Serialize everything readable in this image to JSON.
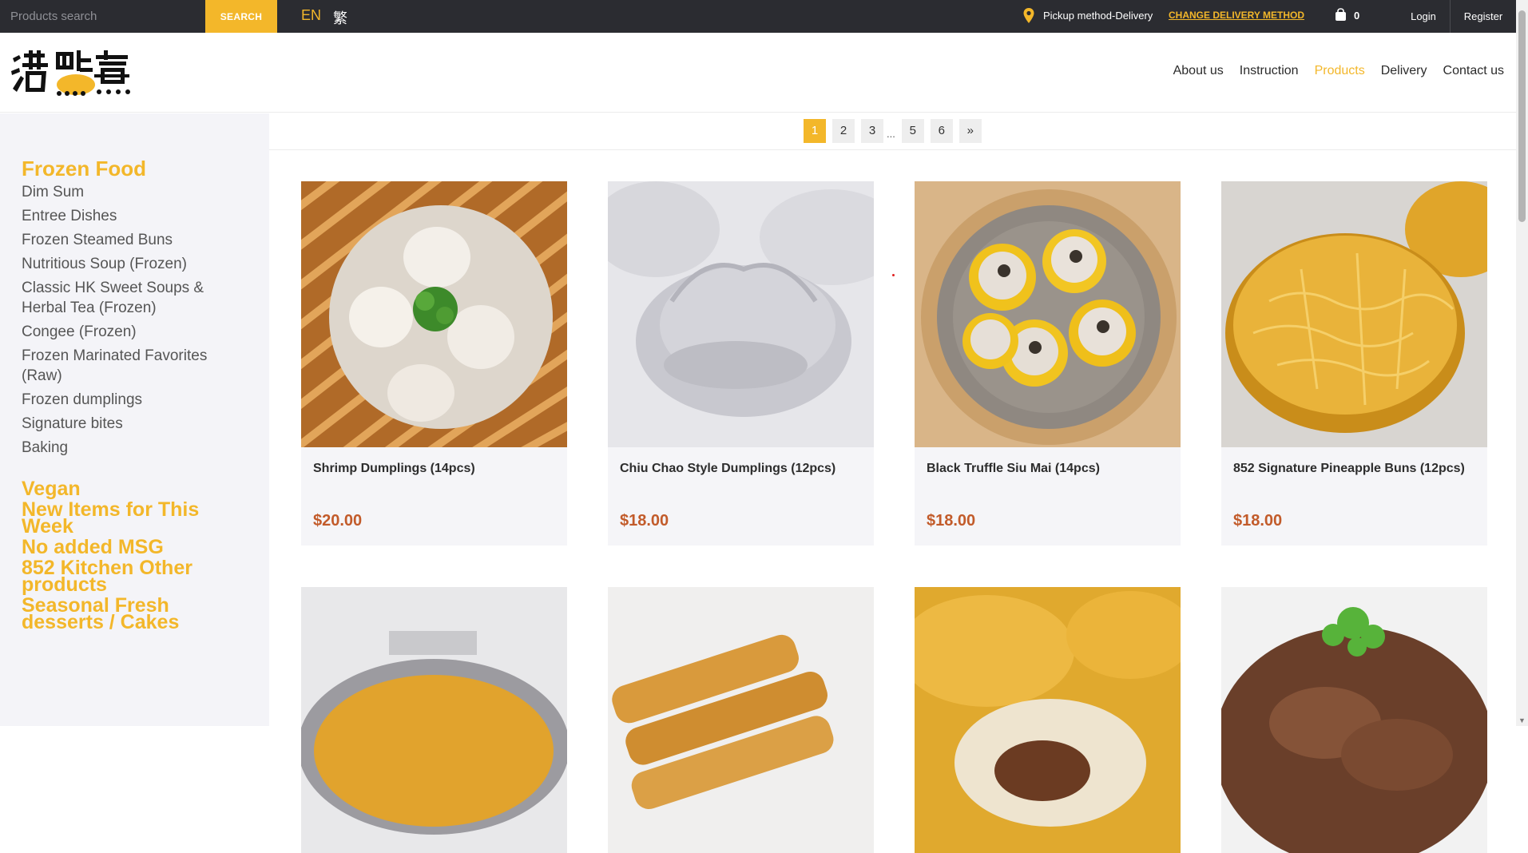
{
  "topbar": {
    "search_placeholder": "Products search",
    "search_button": "SEARCH",
    "lang_en": "EN",
    "lang_tc": "繁",
    "pickup_text": "Pickup method-Delivery",
    "change_delivery": "CHANGE DELIVERY METHOD",
    "cart_count": "0",
    "login": "Login",
    "register": "Register"
  },
  "header": {
    "nav": [
      "About us",
      "Instruction",
      "Products",
      "Delivery",
      "Contact us"
    ],
    "active_nav": "Products"
  },
  "sidebar": {
    "category_title": "Frozen Food",
    "subcategories": [
      "Dim Sum",
      "Entree Dishes",
      "Frozen Steamed Buns",
      "Nutritious Soup (Frozen)",
      "Classic HK Sweet Soups & Herbal Tea (Frozen)",
      "Congee (Frozen)",
      "Frozen Marinated Favorites (Raw)",
      "Frozen dumplings",
      "Signature bites",
      "Baking"
    ],
    "main_categories": [
      "Vegan",
      "New Items for This Week",
      "No added MSG",
      "852 Kitchen Other products",
      "Seasonal Fresh desserts / Cakes"
    ]
  },
  "pagination": {
    "pages": [
      "1",
      "2",
      "3",
      "5",
      "6"
    ],
    "ellipsis": "...",
    "next": "»",
    "current": "1"
  },
  "products": [
    {
      "name": "Shrimp Dumplings (14pcs)",
      "price": "$20.00"
    },
    {
      "name": "Chiu Chao Style Dumplings (12pcs)",
      "price": "$18.00"
    },
    {
      "name": "Black Truffle Siu Mai (14pcs)",
      "price": "$18.00"
    },
    {
      "name": "852 Signature Pineapple Buns (12pcs)",
      "price": "$18.00"
    }
  ],
  "colors": {
    "accent": "#f3b72a",
    "topbar_bg": "#2b2c31",
    "price": "#c25b2a",
    "sidebar_bg": "#f4f4f8"
  }
}
